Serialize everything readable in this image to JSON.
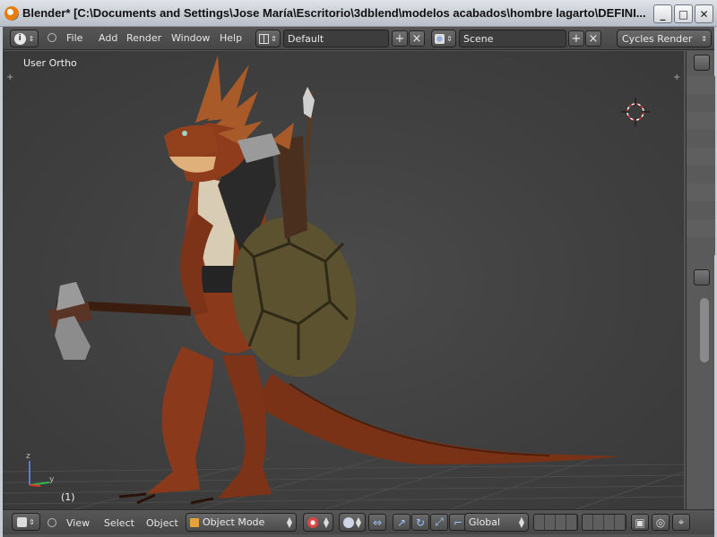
{
  "window": {
    "title": "Blender* [C:\\Documents and Settings\\Jose María\\Escritorio\\3dblend\\modelos acabados\\hombre lagarto\\DEFINI...",
    "minimize_glyph": "_",
    "maximize_glyph": "□",
    "close_glyph": "✕"
  },
  "info_header": {
    "editor_icon": "i",
    "menus": [
      "File",
      "Add",
      "Render",
      "Window",
      "Help"
    ],
    "screen_layout": "Default",
    "scene": "Scene",
    "render_engine": "Cycles Render",
    "add_glyph": "+",
    "remove_glyph": "×"
  },
  "viewport": {
    "view_label": "User Ortho",
    "frame_label": "(1)",
    "axis_labels": {
      "z": "z",
      "y": "y"
    }
  },
  "view3d_header": {
    "menus": [
      "View",
      "Select",
      "Object"
    ],
    "mode": "Object Mode",
    "transform_orientation": "Global"
  },
  "colors": {
    "viewport_bg": "#3f3f3f",
    "header_bg": "#4e4e4e",
    "lizard_skin": "#8a3a1a",
    "shell": "#5c5230"
  }
}
